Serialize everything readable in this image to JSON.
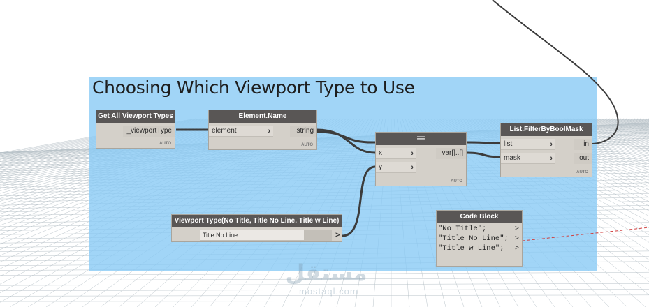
{
  "group": {
    "title": "Choosing Which Viewport Type to Use"
  },
  "nodes": {
    "get_all": {
      "title": "Get All Viewport Types",
      "output": "_viewportType",
      "lacing": "AUTO"
    },
    "element_name": {
      "title": "Element.Name",
      "input": "element",
      "output": "string",
      "lacing": "AUTO"
    },
    "equals": {
      "title": "==",
      "inputs": [
        "x",
        "y"
      ],
      "output": "var[]..[]",
      "lacing": "AUTO"
    },
    "filter": {
      "title": "List.FilterByBoolMask",
      "inputs": [
        "list",
        "mask"
      ],
      "outputs": [
        "in",
        "out"
      ],
      "lacing": "AUTO"
    },
    "viewport_type": {
      "title": "Viewport Type(No Title, Title No Line, Title w Line)",
      "selected": "Title No Line"
    },
    "code_block": {
      "title": "Code Block",
      "lines": [
        "\"No Title\";",
        "\"Title No Line\";",
        "\"Title w Line\";"
      ]
    }
  },
  "watermark": {
    "text": "مستقل",
    "sub": "mostaql.com"
  },
  "colors": {
    "group_fill": "#87c9f5",
    "node_header": "#595655",
    "node_body": "#d4d0c9",
    "wire": "#3c3c3c"
  }
}
